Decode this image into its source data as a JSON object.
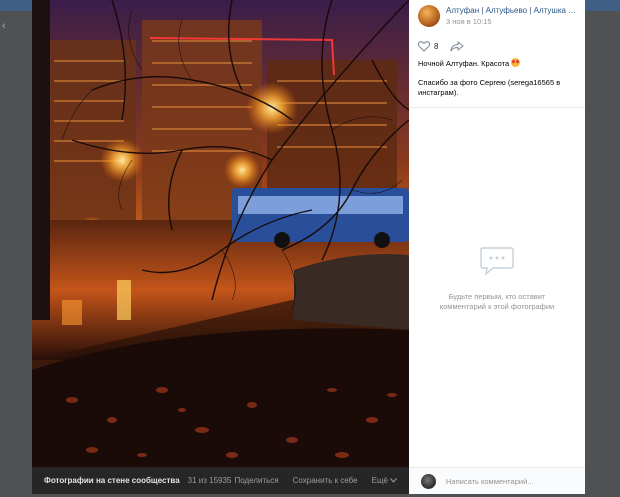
{
  "post": {
    "group_name": "Алтуфан | Алтуфьево | Алтушка | С...",
    "date": "3 ноя в 10:15",
    "like_count": "8",
    "text_line1": "Ночной Алтуфан. Красота",
    "text_line2": "Спасибо за фото Сергею (serega16565 в инстаграм)."
  },
  "comments": {
    "empty_text": "Будьте первым, кто оставит комментарий к этой фотографии",
    "input_placeholder": "Написать комментарий..."
  },
  "photo_footer": {
    "album": "Фотографии на стене сообщества",
    "counter": "31 из 15935",
    "share": "Поделиться",
    "save": "Сохранить к себе",
    "more": "Ещё"
  },
  "icons": {
    "like": "heart-icon",
    "share": "share-icon",
    "comments_placeholder": "chat-bubble-icon",
    "more": "chevron-down-icon"
  },
  "colors": {
    "link": "#2a5885",
    "topbar": "#3f5f85",
    "muted": "#939393"
  }
}
